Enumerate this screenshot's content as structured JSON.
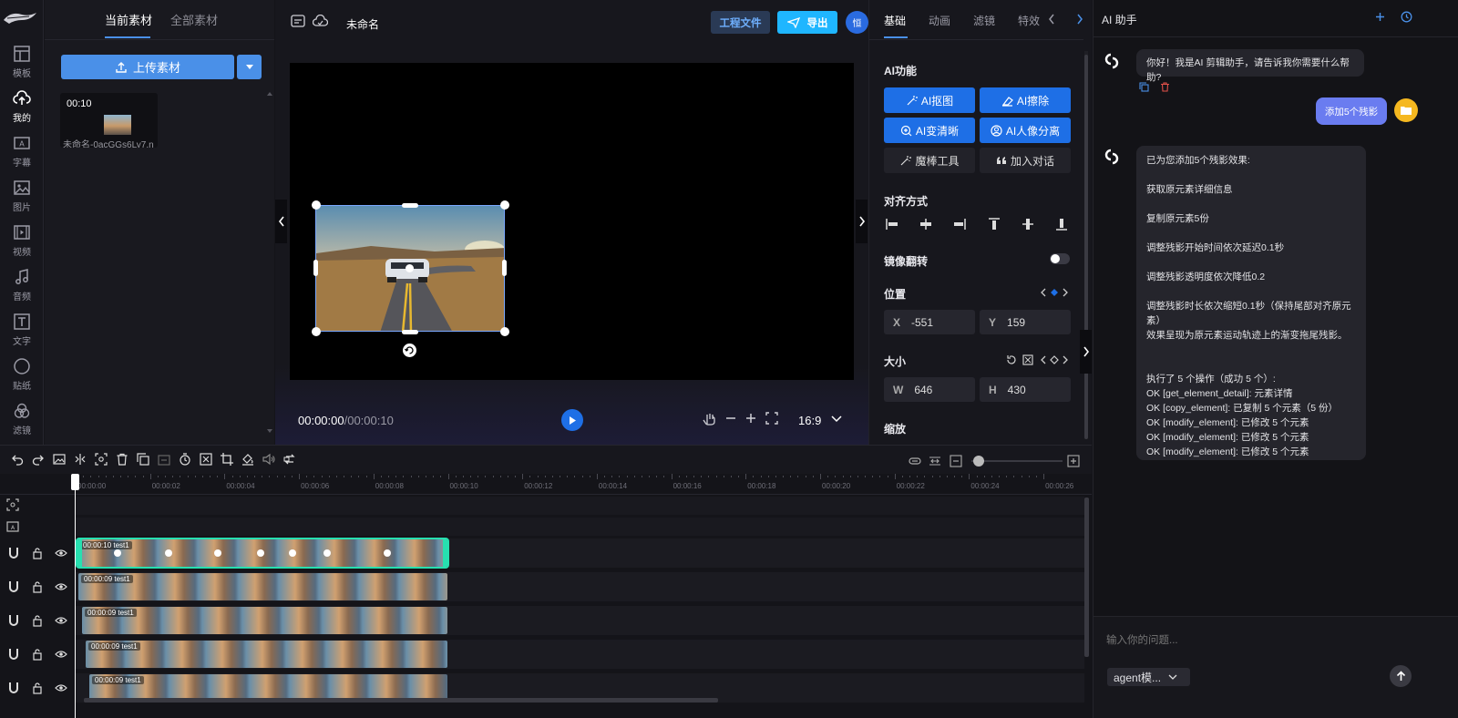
{
  "nav": {
    "items": [
      {
        "label": "模板",
        "icon": "template-icon"
      },
      {
        "label": "我的",
        "icon": "cloud-upload-icon",
        "active": true
      },
      {
        "label": "字幕",
        "icon": "subtitle-icon"
      },
      {
        "label": "图片",
        "icon": "image-icon"
      },
      {
        "label": "视频",
        "icon": "video-icon"
      },
      {
        "label": "音频",
        "icon": "music-icon"
      },
      {
        "label": "文字",
        "icon": "text-icon"
      },
      {
        "label": "贴纸",
        "icon": "sticker-icon"
      },
      {
        "label": "滤镜",
        "icon": "filter-icon"
      }
    ]
  },
  "assets": {
    "tab_current": "当前素材",
    "tab_all": "全部素材",
    "upload_label": "上传素材",
    "item": {
      "duration": "00:10",
      "name": "未命名-0acGGs6Ly7.n"
    }
  },
  "topbar": {
    "title": "未命名",
    "project_button": "工程文件",
    "export_button": "导出",
    "avatar_text": "恒"
  },
  "player": {
    "time": "00:00:00",
    "duration": "/00:00:10",
    "ratio": "16:9"
  },
  "props": {
    "tabs": [
      "基础",
      "动画",
      "滤镜",
      "特效"
    ],
    "ai_section": "AI功能",
    "ai_buttons": [
      "AI抠图",
      "AI擦除",
      "AI变清晰",
      "AI人像分离",
      "魔棒工具",
      "加入对话"
    ],
    "align_section": "对齐方式",
    "mirror_section": "镜像翻转",
    "position_section": "位置",
    "x_label": "X",
    "x_value": "-551",
    "y_label": "Y",
    "y_value": "159",
    "size_section": "大小",
    "w_label": "W",
    "w_value": "646",
    "h_label": "H",
    "h_value": "430",
    "scale_section": "缩放",
    "mirror_on": false
  },
  "assistant": {
    "title": "AI 助手",
    "greeting": "你好！我是AI 剪辑助手，请告诉我你需要什么帮助?",
    "user_message": "添加5个残影",
    "reply_lines": [
      "已为您添加5个残影效果:",
      "",
      "获取原元素详细信息",
      "",
      "复制原元素5份",
      "",
      "调整残影开始时间依次延迟0.1秒",
      "",
      "调整残影透明度依次降低0.2",
      "",
      "调整残影时长依次缩短0.1秒（保持尾部对齐原元素）",
      "效果呈现为原元素运动轨迹上的渐变拖尾残影。",
      "",
      "",
      "执行了 5 个操作（成功 5 个）:",
      "OK [get_element_detail]: 元素详情",
      "OK [copy_element]: 已复制 5 个元素（5 份）",
      "OK [modify_element]: 已修改 5 个元素",
      "OK [modify_element]: 已修改 5 个元素",
      "OK [modify_element]: 已修改 5 个元素"
    ],
    "input_placeholder": "输入你的问题...",
    "mode_select": "agent模..."
  },
  "timeline": {
    "ticks": [
      "00:00:00",
      "00:00:02",
      "00:00:04",
      "00:00:06",
      "00:00:08",
      "00:00:10",
      "00:00:12",
      "00:00:14",
      "00:00:16",
      "00:00:18",
      "00:00:20",
      "00:00:22",
      "00:00:24",
      "00:00:26"
    ],
    "clips": [
      {
        "time": "00:00:10",
        "name": "test1"
      },
      {
        "time": "00:00:09",
        "name": "test1"
      },
      {
        "time": "00:00:09",
        "name": "test1"
      },
      {
        "time": "00:00:09",
        "name": "test1"
      },
      {
        "time": "00:00:09",
        "name": "test1"
      }
    ]
  },
  "colors": {
    "accent": "#1e6fe6",
    "export": "#1fb6ff",
    "selected_clip": "#27e0b0"
  }
}
